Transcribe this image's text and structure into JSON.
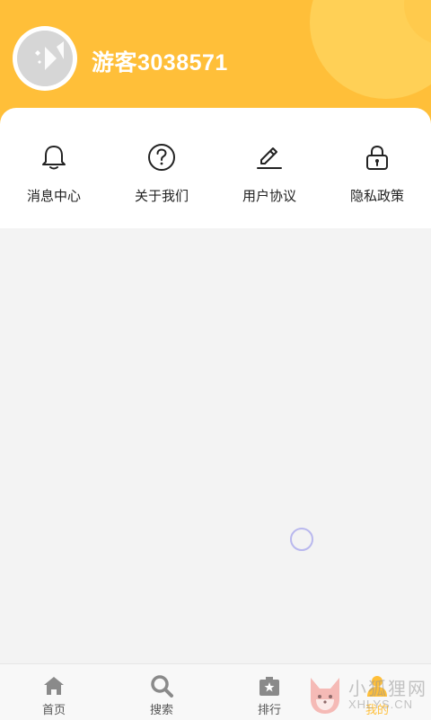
{
  "profile": {
    "username": "游客3038571"
  },
  "menu": {
    "items": [
      {
        "label": "消息中心",
        "icon": "bell-icon"
      },
      {
        "label": "关于我们",
        "icon": "question-circle-icon"
      },
      {
        "label": "用户协议",
        "icon": "pen-icon"
      },
      {
        "label": "隐私政策",
        "icon": "lock-icon"
      }
    ]
  },
  "tabbar": {
    "items": [
      {
        "label": "首页",
        "icon": "home-icon"
      },
      {
        "label": "搜索",
        "icon": "search-icon"
      },
      {
        "label": "排行",
        "icon": "rank-icon"
      },
      {
        "label": "我的",
        "icon": "user-icon"
      }
    ],
    "active_index": 3
  },
  "watermark": {
    "text": "小狐狸网",
    "sub": "XHLYS.CN"
  },
  "colors": {
    "accent": "#ffbf39",
    "background": "#f3f3f3",
    "spinner": "#b9b8ee"
  }
}
